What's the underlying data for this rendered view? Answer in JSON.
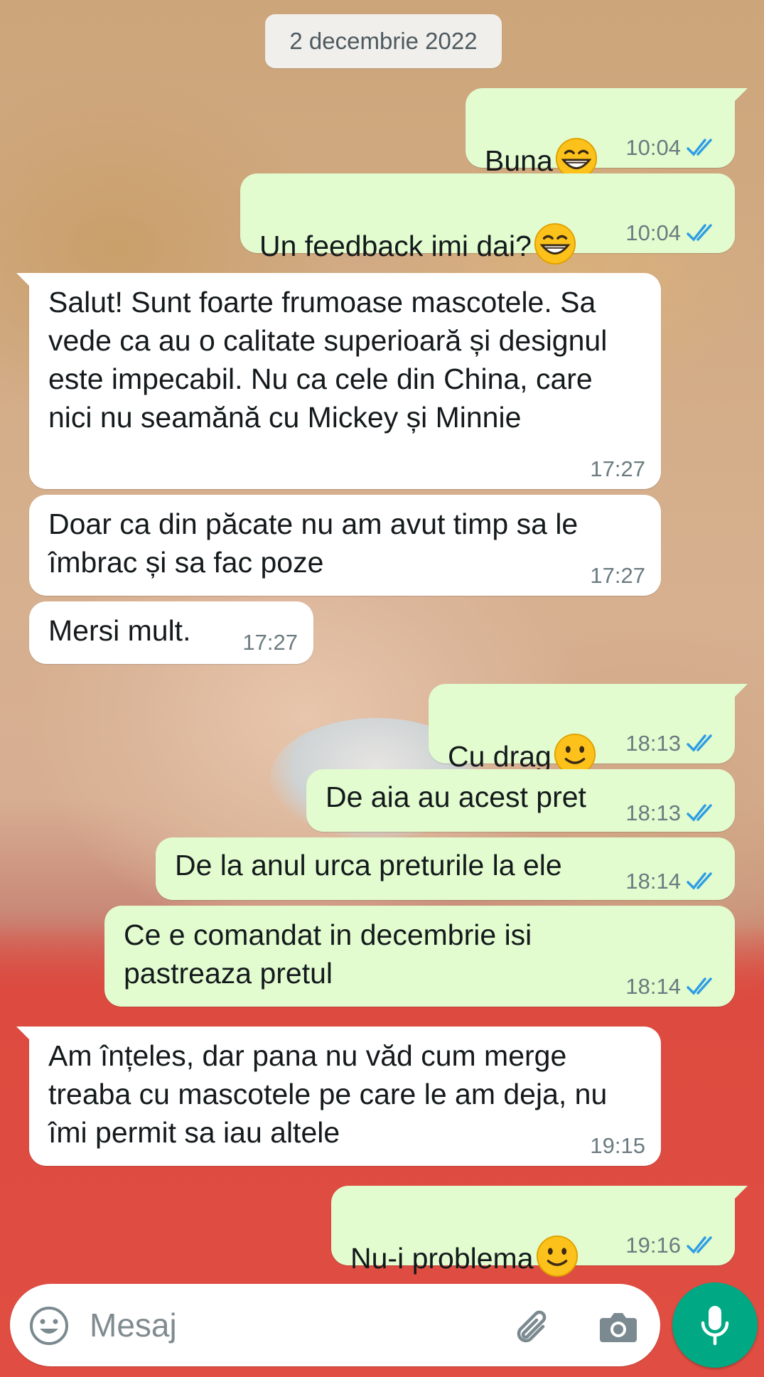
{
  "chat": {
    "date_chip": "2 decembrie 2022",
    "messages": [
      {
        "dir": "out",
        "text": "Buna",
        "emoji": "grinning-face",
        "time": "10:04",
        "status": "read"
      },
      {
        "dir": "out",
        "text": "Un feedback imi dai?",
        "emoji": "grinning-face",
        "time": "10:04",
        "status": "read"
      },
      {
        "dir": "in",
        "text": "Salut! Sunt foarte frumoase mascotele. Sa vede ca au o calitate superioară și designul este impecabil. Nu ca cele din China, care nici nu seamănă cu Mickey și Minnie",
        "time": "17:27"
      },
      {
        "dir": "in",
        "text": "Doar ca din păcate nu am avut timp sa le îmbrac și sa fac poze",
        "time": "17:27"
      },
      {
        "dir": "in",
        "text": "Mersi mult.",
        "time": "17:27"
      },
      {
        "dir": "out",
        "text": "Cu drag",
        "emoji": "slightly-smiling-face",
        "time": "18:13",
        "status": "read"
      },
      {
        "dir": "out",
        "text": "De aia au acest pret",
        "time": "18:13",
        "status": "read"
      },
      {
        "dir": "out",
        "text": "De la anul urca preturile la ele",
        "time": "18:14",
        "status": "read"
      },
      {
        "dir": "out",
        "text": "Ce e comandat in decembrie isi pastreaza pretul",
        "time": "18:14",
        "status": "read"
      },
      {
        "dir": "in",
        "text": "Am înțeles, dar pana nu văd cum merge treaba cu mascotele pe care le am deja, nu îmi permit sa iau altele",
        "time": "19:15"
      },
      {
        "dir": "out",
        "text": "Nu-i problema",
        "emoji": "slightly-smiling-face",
        "time": "19:16",
        "status": "read"
      }
    ]
  },
  "composer": {
    "placeholder": "Mesaj",
    "icons": [
      "emoji-icon",
      "attach-icon",
      "camera-icon",
      "mic-icon"
    ]
  },
  "colors": {
    "outgoing_bubble": "#e2fccf",
    "incoming_bubble": "#ffffff",
    "read_ticks": "#2f9de4",
    "mic_button": "#00a884"
  }
}
